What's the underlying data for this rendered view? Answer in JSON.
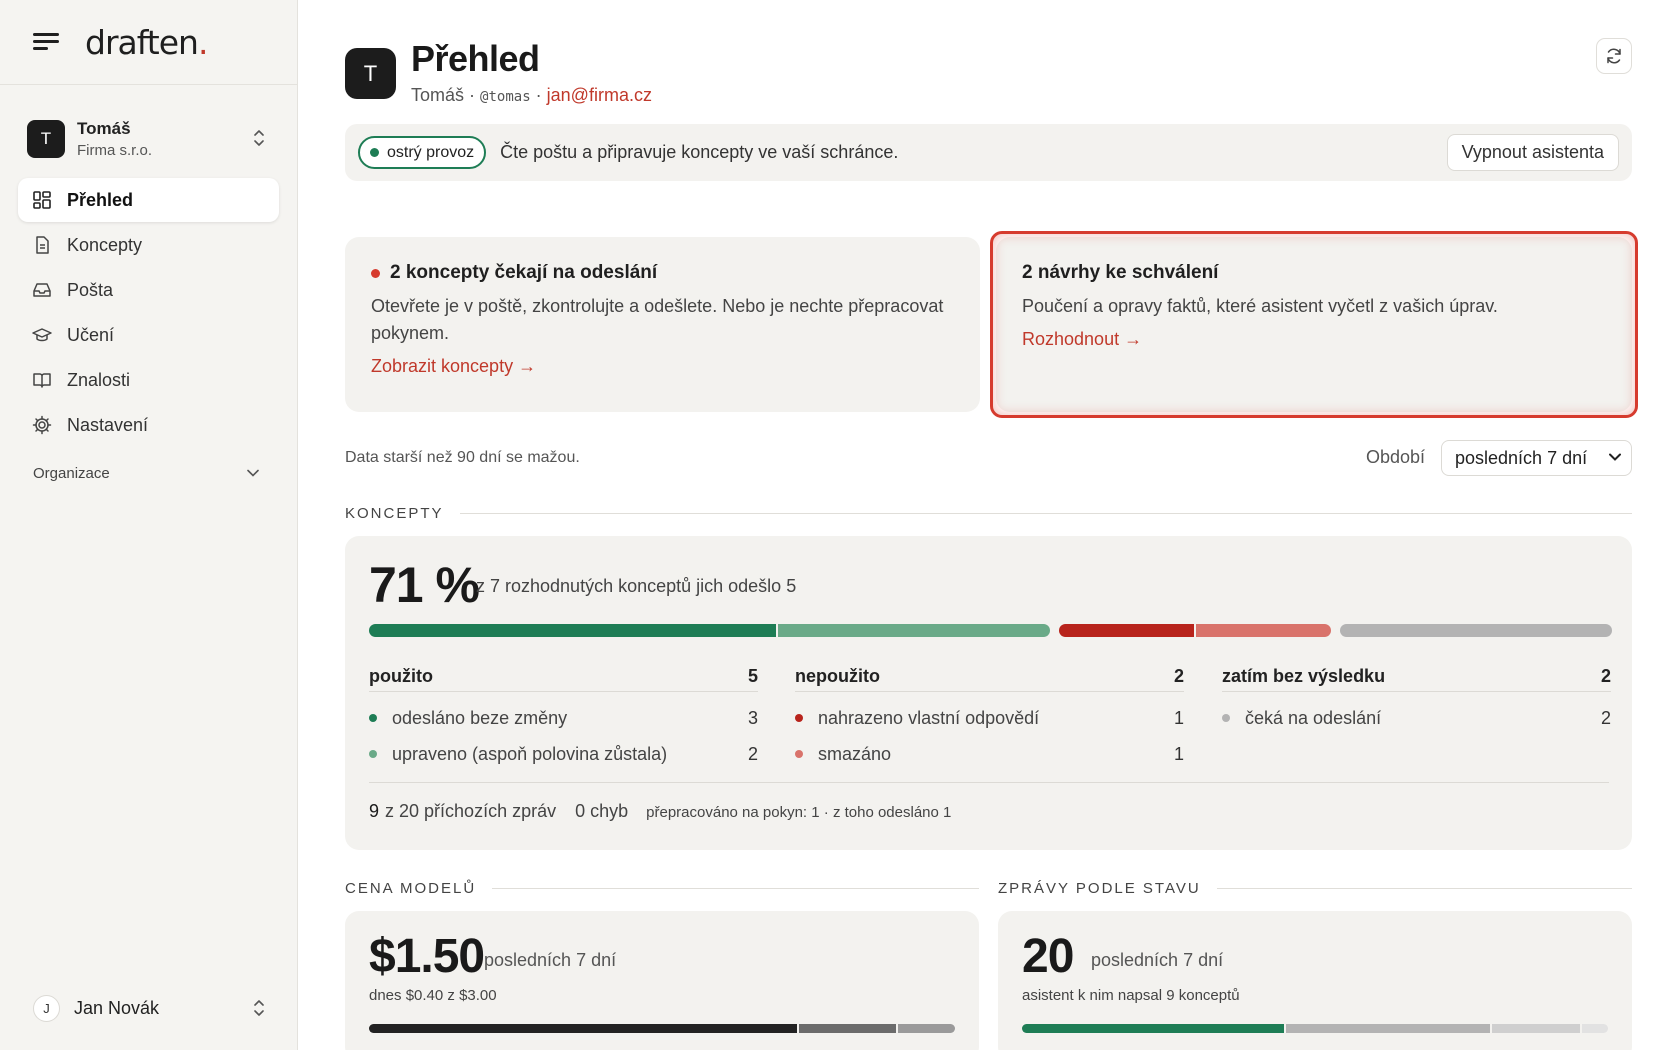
{
  "brand": {
    "logo": "draften",
    "logo_dot": "."
  },
  "account": {
    "avatar_letter": "T",
    "name": "Tomáš",
    "company": "Firma s.r.o."
  },
  "nav": [
    {
      "label": "Přehled",
      "icon": "grid-icon",
      "active": true
    },
    {
      "label": "Koncepty",
      "icon": "document-icon"
    },
    {
      "label": "Pošta",
      "icon": "inbox-icon"
    },
    {
      "label": "Učení",
      "icon": "graduation-cap-icon"
    },
    {
      "label": "Znalosti",
      "icon": "book-icon"
    },
    {
      "label": "Nastavení",
      "icon": "gear-icon"
    }
  ],
  "org_label": "Organizace",
  "user": {
    "avatar_letter": "J",
    "name": "Jan Novák"
  },
  "header": {
    "avatar_letter": "T",
    "title": "Přehled",
    "name": "Tomáš",
    "sep1": "·",
    "handle": "@tomas",
    "sep2": "·",
    "email": "jan@firma.cz"
  },
  "status": {
    "pill": "ostrý provoz",
    "text": "Čte poštu a připravuje koncepty ve vaší schránce.",
    "button": "Vypnout asistenta"
  },
  "cards": {
    "drafts": {
      "title": "2 koncepty čekají na odeslání",
      "text": "Otevřete je v poště, zkontrolujte a odešlete. Nebo je nechte přepracovat pokynem.",
      "link": "Zobrazit koncepty →"
    },
    "proposals": {
      "title": "2 návrhy ke schválení",
      "text": "Poučení a opravy faktů, které asistent vyčetl z vašich úprav.",
      "link": "Rozhodnout →"
    }
  },
  "retention": "Data starší než 90 dní se mažou.",
  "period": {
    "label": "Období",
    "value": "posledních 7 dní"
  },
  "sections": {
    "drafts": "KONCEPTY",
    "cost": "CENA MODELŮ",
    "messages": "ZPRÁVY PODLE STAVU"
  },
  "drafts_stats": {
    "percent": "71 %",
    "subtitle": "z 7 rozhodnutých konceptů jich odešlo 5",
    "groups": [
      {
        "title": "použito",
        "total": "5",
        "rows": [
          {
            "label": "odesláno beze změny",
            "value": "3",
            "color": "#1e7d55"
          },
          {
            "label": "upraveno (aspoň polovina zůstala)",
            "value": "2",
            "color": "#6aaa88"
          }
        ]
      },
      {
        "title": "nepoužito",
        "total": "2",
        "rows": [
          {
            "label": "nahrazeno vlastní odpovědí",
            "value": "1",
            "color": "#b8241c"
          },
          {
            "label": "smazáno",
            "value": "1",
            "color": "#d9736b"
          }
        ]
      },
      {
        "title": "zatím bez výsledku",
        "total": "2",
        "rows": [
          {
            "label": "čeká na odeslání",
            "value": "2",
            "color": "#b3b3b3"
          }
        ]
      }
    ],
    "footer": {
      "incoming_count": "9",
      "incoming_text": "z 20 příchozích zpráv",
      "errors": "0 chyb",
      "reworked": "přepracováno na pokyn: 1 · z toho odesláno 1"
    }
  },
  "cost": {
    "value": "$1.50",
    "period": "posledních 7 dní",
    "note": "dnes $0.40 z $3.00"
  },
  "messages": {
    "value": "20",
    "period": "posledních 7 dní",
    "note": "asistent k nim napsal 9 konceptů"
  }
}
